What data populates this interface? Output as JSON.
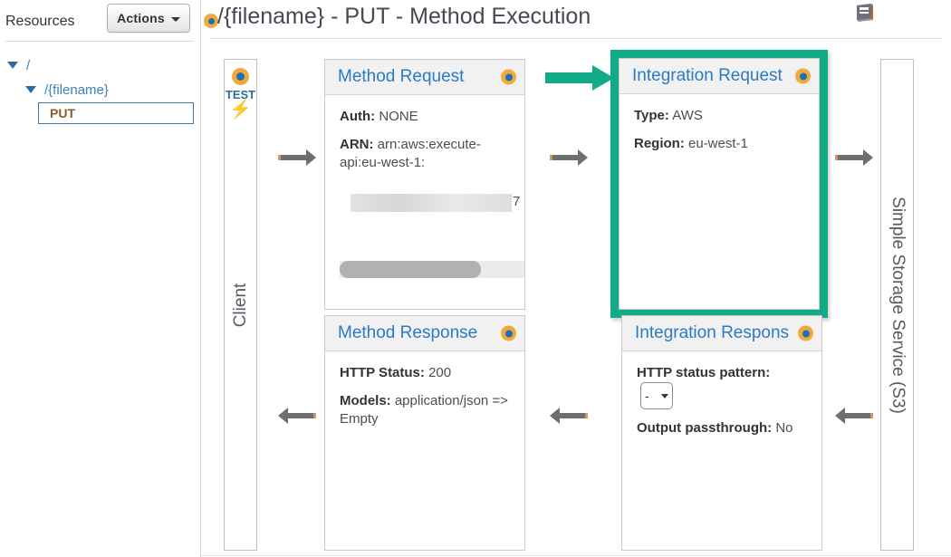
{
  "sidebar": {
    "resources_label": "Resources",
    "actions_button": "Actions",
    "tree": {
      "root": "/",
      "child": "/{filename}",
      "method": "PUT"
    }
  },
  "header": {
    "title": "/{filename} - PUT - Method Execution",
    "status_icon": "status-dot-icon",
    "docs_icon": "book-icon"
  },
  "canvas": {
    "client_lane": {
      "label": "Client",
      "test_label": "TEST",
      "test_icon": "lightning-bolt-icon"
    },
    "backend_lane": {
      "label": "Simple Storage Service (S3)"
    },
    "nodes": {
      "method_request": {
        "title": "Method Request",
        "fields": [
          {
            "key": "Auth:",
            "value": "NONE"
          },
          {
            "key": "ARN:",
            "value": "arn:aws:execute-api:eu-west-1:"
          }
        ],
        "redacted_suffix": "7"
      },
      "integration_request": {
        "title": "Integration Request",
        "highlighted": true,
        "highlight_color": "#11ab87",
        "fields": [
          {
            "key": "Type:",
            "value": "AWS"
          },
          {
            "key": "Region:",
            "value": "eu-west-1"
          }
        ]
      },
      "method_response": {
        "title": "Method Response",
        "fields": [
          {
            "key": "HTTP Status:",
            "value": "200"
          },
          {
            "key": "Models:",
            "value": "application/json => Empty"
          }
        ]
      },
      "integration_response": {
        "title": "Integration Respons",
        "fields": [
          {
            "key": "HTTP status pattern:",
            "value": "-"
          },
          {
            "key": "Output passthrough:",
            "value": "No"
          }
        ],
        "status_pattern_selected": "-"
      }
    },
    "arrows": {
      "client_to_method_request": "arrow-right",
      "method_request_to_integration_request": "arrow-right",
      "integration_request_to_backend": "arrow-right",
      "method_response_to_client": "arrow-left",
      "integration_response_to_method_response": "arrow-left",
      "backend_to_integration_response": "arrow-left"
    }
  },
  "colors": {
    "accent_blue": "#2b7bc4",
    "status_orange": "#f2a93b",
    "highlight_teal": "#11ab87",
    "method_label_brown": "#8a5a2b"
  }
}
